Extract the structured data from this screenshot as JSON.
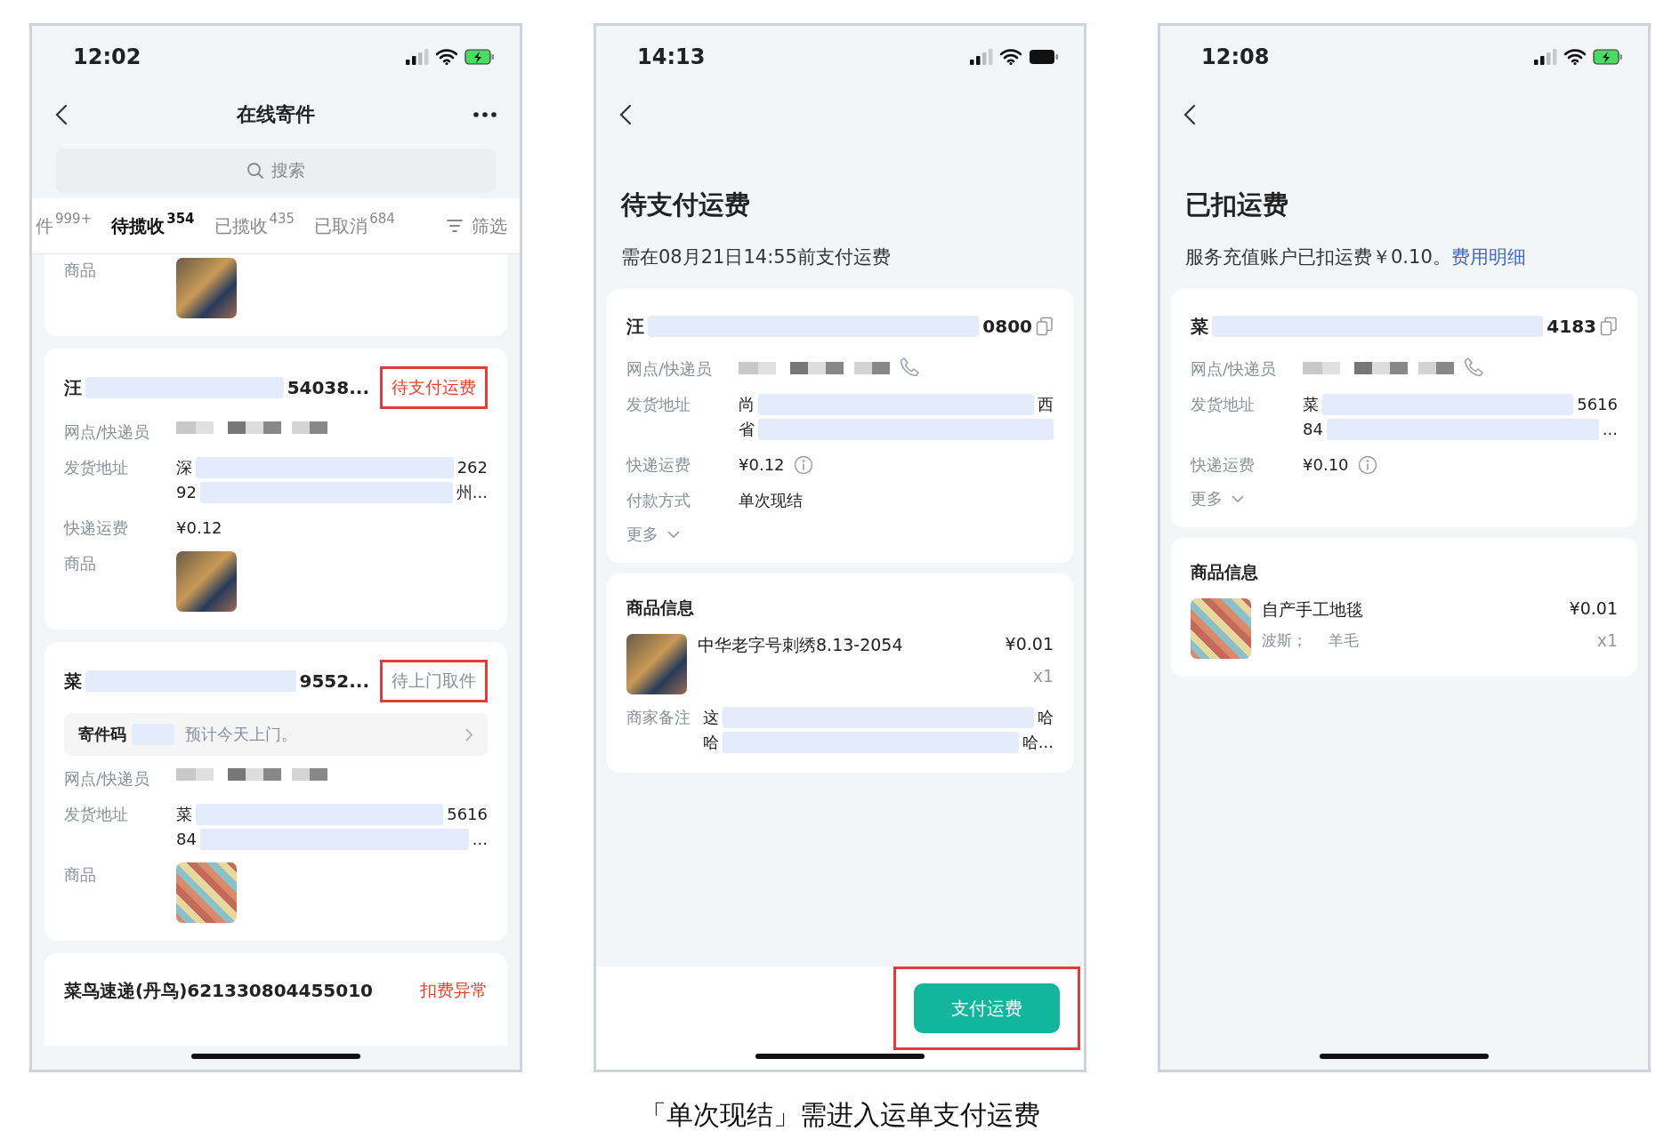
{
  "phones": [
    {
      "kind": "list",
      "status_bar": {
        "time": "12:02",
        "battery_charging": true
      },
      "nav": {
        "title": "在线寄件",
        "more": true
      },
      "search": {
        "placeholder": "搜索"
      },
      "tabs": [
        {
          "label": "件",
          "count": "999+",
          "selected": false
        },
        {
          "label": "待揽收",
          "count": "354",
          "selected": true
        },
        {
          "label": "已揽收",
          "count": "435",
          "selected": false
        },
        {
          "label": "已取消",
          "count": "684",
          "selected": false
        }
      ],
      "filter": "筛选",
      "orders": [
        {
          "kind": "partial_top",
          "rows": [
            {
              "kind": "image",
              "label": "商品"
            }
          ]
        },
        {
          "kind": "full",
          "header": {
            "start": "汪",
            "end": "54038..."
          },
          "tag": {
            "label": "待支付运费",
            "color": "#e8412f",
            "annotated": true
          },
          "rows": [
            {
              "kind": "courier",
              "label": "网点/快递员",
              "call_icon": false
            },
            {
              "kind": "address",
              "label": "发货地址",
              "lines": [
                {
                  "start": "深",
                  "end": "262"
                },
                {
                  "start": "92",
                  "end": "州..."
                }
              ]
            },
            {
              "kind": "text",
              "label": "快递运费",
              "value": "¥0.12"
            },
            {
              "kind": "image",
              "label": "商品"
            }
          ]
        },
        {
          "kind": "full",
          "header": {
            "start": "菜",
            "end": "9552..."
          },
          "tag": {
            "label": "待上门取件",
            "color": "#8a8f99",
            "annotated": true
          },
          "pickup": {
            "label": "寄件码",
            "note": "预计今天上门。"
          },
          "rows": [
            {
              "kind": "courier",
              "label": "网点/快递员",
              "call_icon": false
            },
            {
              "kind": "address",
              "label": "发货地址",
              "lines": [
                {
                  "start": "菜",
                  "end": "5616"
                },
                {
                  "start": "84",
                  "end": "..."
                }
              ]
            },
            {
              "kind": "image",
              "label": "商品"
            }
          ]
        },
        {
          "kind": "partial_bottom",
          "header": {
            "start": "菜鸟速递(丹鸟)621330804455010"
          },
          "tag": {
            "label": "扣费异常",
            "color": "#e8412f",
            "annotated": false
          }
        }
      ]
    },
    {
      "kind": "detail",
      "status_bar": {
        "time": "14:13",
        "battery_charging": false
      },
      "title": "待支付运费",
      "subtitle": "需在08月21日14:55前支付运费",
      "card": {
        "header": {
          "start": "汪",
          "end": "0800"
        },
        "rows": [
          {
            "kind": "courier",
            "label": "网点/快递员",
            "call_icon": true
          },
          {
            "kind": "address",
            "label": "发货地址",
            "lines": [
              {
                "start": "尚",
                "end": "西"
              },
              {
                "start": "省"
              }
            ]
          },
          {
            "kind": "fee",
            "label": "快递运费",
            "value": "¥0.12"
          },
          {
            "kind": "text",
            "label": "付款方式",
            "value": "单次现结"
          },
          {
            "kind": "more",
            "label": "更多"
          }
        ]
      },
      "goods": {
        "title": "商品信息",
        "items": [
          {
            "name": "中华老字号刺绣8.13-2054",
            "price": "¥0.01",
            "qty": "x1"
          }
        ],
        "remark": {
          "label": "商家备注",
          "lines": [
            {
              "start": "这",
              "end": "哈"
            },
            {
              "start": "哈",
              "end": "哈..."
            }
          ]
        }
      },
      "action": {
        "label": "支付运费",
        "annotated": true
      }
    },
    {
      "kind": "detail",
      "status_bar": {
        "time": "12:08",
        "battery_charging": true
      },
      "title": "已扣运费",
      "subtitle": "服务充值账户已扣运费￥0.10。",
      "subtitle_link": "费用明细",
      "card": {
        "header": {
          "start": "菜",
          "end": "4183"
        },
        "rows": [
          {
            "kind": "courier",
            "label": "网点/快递员",
            "call_icon": true
          },
          {
            "kind": "address",
            "label": "发货地址",
            "lines": [
              {
                "start": "菜",
                "end": "5616"
              },
              {
                "start": "84",
                "end": "..."
              }
            ]
          },
          {
            "kind": "fee",
            "label": "快递运费",
            "value": "¥0.10"
          },
          {
            "kind": "more",
            "label": "更多"
          }
        ]
      },
      "goods": {
        "title": "商品信息",
        "items": [
          {
            "name": "自产手工地毯",
            "price": "¥0.01",
            "qty": "x1",
            "specs": [
              "波斯；",
              "羊毛"
            ]
          }
        ]
      }
    }
  ],
  "caption": "「单次现结」需进入运单支付运费"
}
